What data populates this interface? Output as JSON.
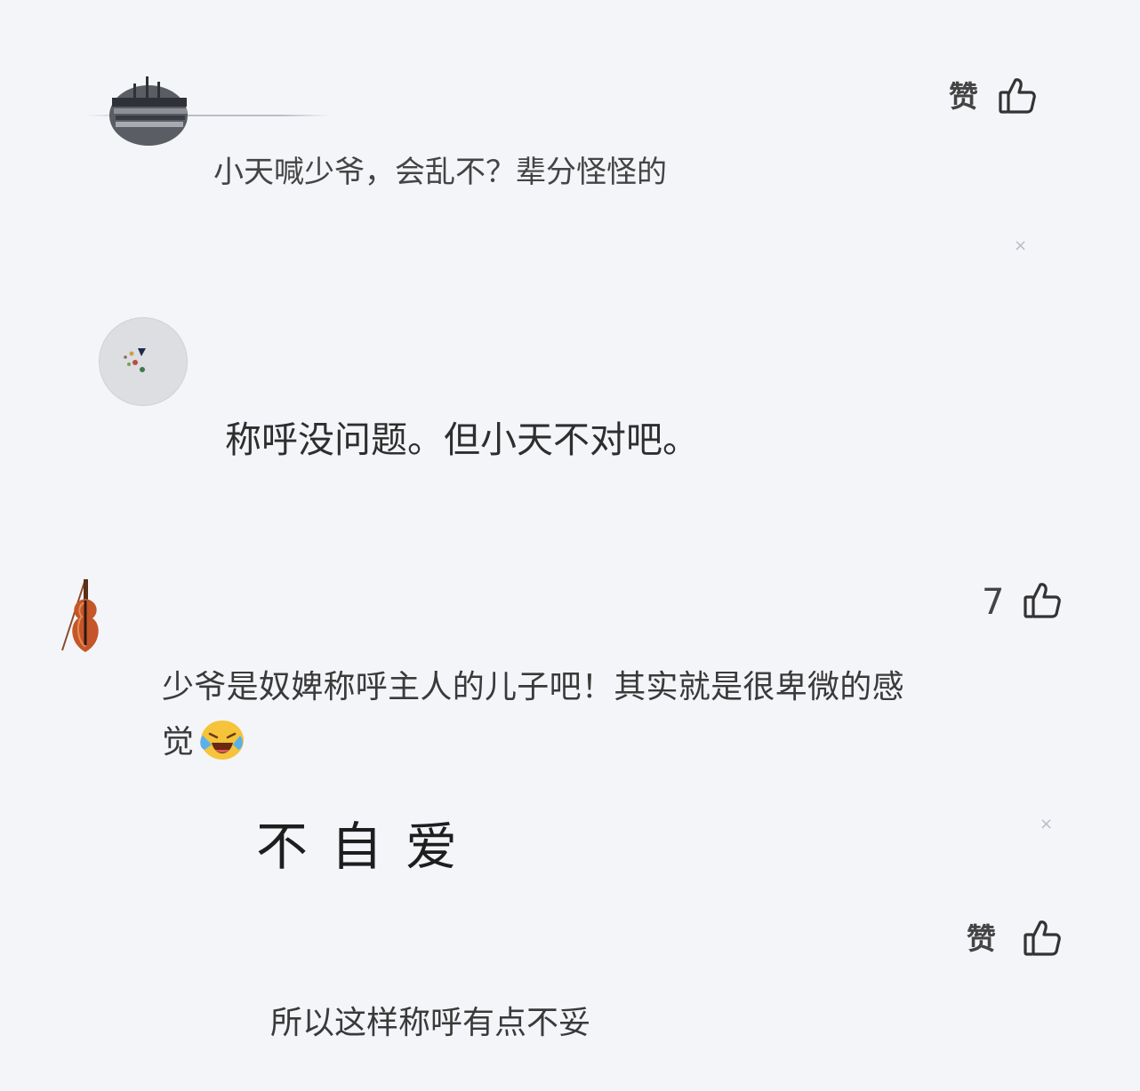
{
  "comments": [
    {
      "like_label": "赞",
      "text": "小天喊少爷，会乱不？辈分怪怪的",
      "close": "×"
    },
    {
      "text": "称呼没问题。但小天不对吧。"
    },
    {
      "like_count": "7",
      "text_line1": "少爷是奴婢称呼主人的儿子吧！其实就是很卑微的感",
      "text_line2": "觉",
      "emoji": "crying-laughing-emoji"
    },
    {
      "text": "不自爱",
      "close": "×",
      "like_label": "赞"
    },
    {
      "text": "所以这样称呼有点不妥"
    }
  ],
  "icons": {
    "like": "thumbs-up-icon",
    "close": "close-icon"
  }
}
